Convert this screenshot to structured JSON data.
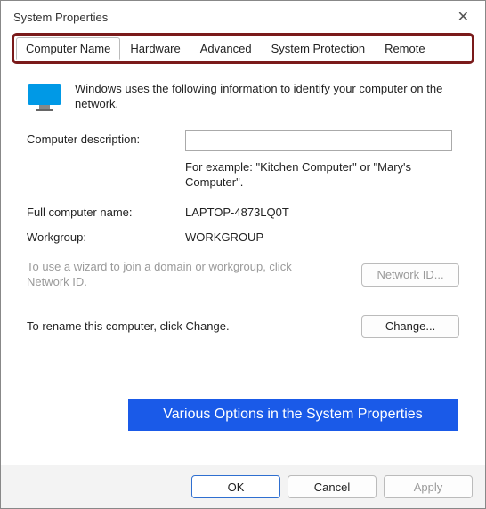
{
  "window": {
    "title": "System Properties"
  },
  "tabs": {
    "items": [
      "Computer Name",
      "Hardware",
      "Advanced",
      "System Protection",
      "Remote"
    ],
    "active": 0
  },
  "intro": {
    "text": "Windows uses the following information to identify your computer on the network."
  },
  "desc": {
    "label": "Computer description:",
    "value": "",
    "example": "For example: \"Kitchen Computer\" or \"Mary's Computer\"."
  },
  "fullname": {
    "label": "Full computer name:",
    "value": "LAPTOP-4873LQ0T"
  },
  "workgroup": {
    "label": "Workgroup:",
    "value": "WORKGROUP"
  },
  "wizard": {
    "text": "To use a wizard to join a domain or workgroup, click Network ID.",
    "button": "Network ID..."
  },
  "rename": {
    "text": "To rename this computer, click Change.",
    "button": "Change..."
  },
  "callout": {
    "text": "Various Options in the System Properties"
  },
  "footer": {
    "ok": "OK",
    "cancel": "Cancel",
    "apply": "Apply"
  }
}
